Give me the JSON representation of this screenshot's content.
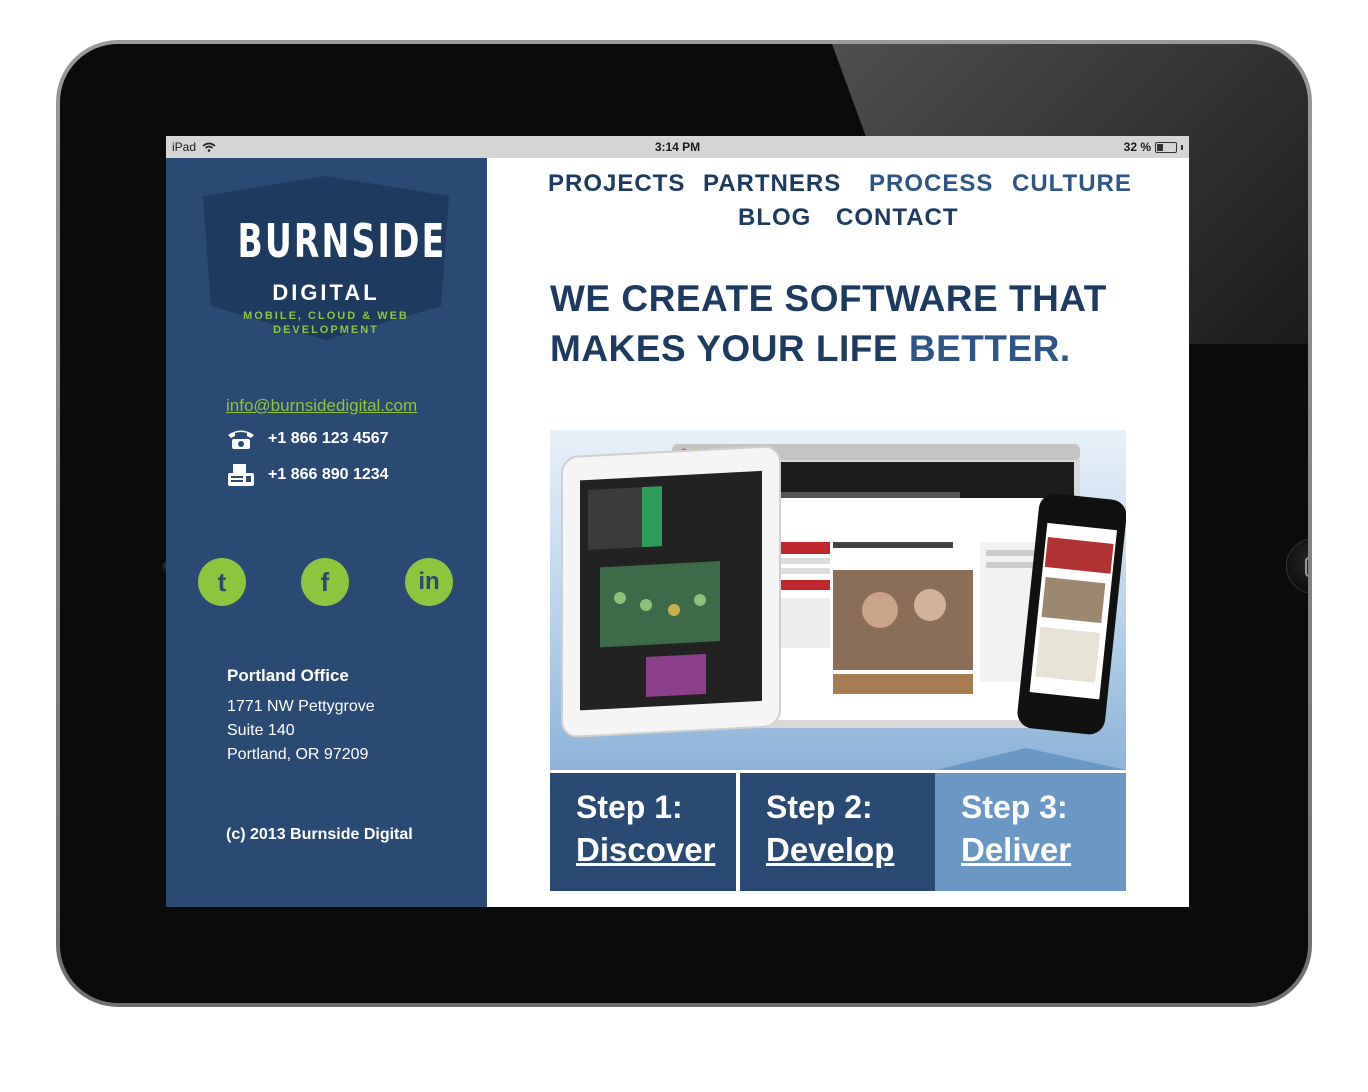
{
  "status_bar": {
    "device": "iPad",
    "time": "3:14 PM",
    "battery_text": "32 %",
    "battery_level": 0.32
  },
  "logo": {
    "name": "BURNSIDE",
    "sub": "DIGITAL",
    "tagline_line1": "MOBILE, CLOUD & WEB",
    "tagline_line2": "DEVELOPMENT"
  },
  "sidebar": {
    "email": "info@burnsidedigital.com",
    "phone": "+1 866 123 4567",
    "fax": "+1 866 890 1234",
    "office_title": "Portland Office",
    "address_line1": "1771 NW Pettygrove",
    "address_line2": "Suite 140",
    "address_line3": "Portland, OR 97209",
    "copyright": "(c) 2013 Burnside Digital"
  },
  "nav": {
    "projects": "PROJECTS",
    "partners": "PARTNERS",
    "process": "PROCESS",
    "culture": "CULTURE",
    "blog": "BLOG",
    "contact": "CONTACT"
  },
  "hero": {
    "line1": "WE CREATE SOFTWARE THAT",
    "line2_a": "MAKES YOUR LIFE ",
    "line2_b": "BETTER."
  },
  "steps": [
    {
      "label": "Step 1:",
      "link": "Discover"
    },
    {
      "label": "Step 2:",
      "link": "Develop"
    },
    {
      "label": "Step 3:",
      "link": "Deliver"
    }
  ],
  "colors": {
    "navy": "#2b4a73",
    "green": "#8cc63f",
    "step3": "#6b97c5"
  }
}
